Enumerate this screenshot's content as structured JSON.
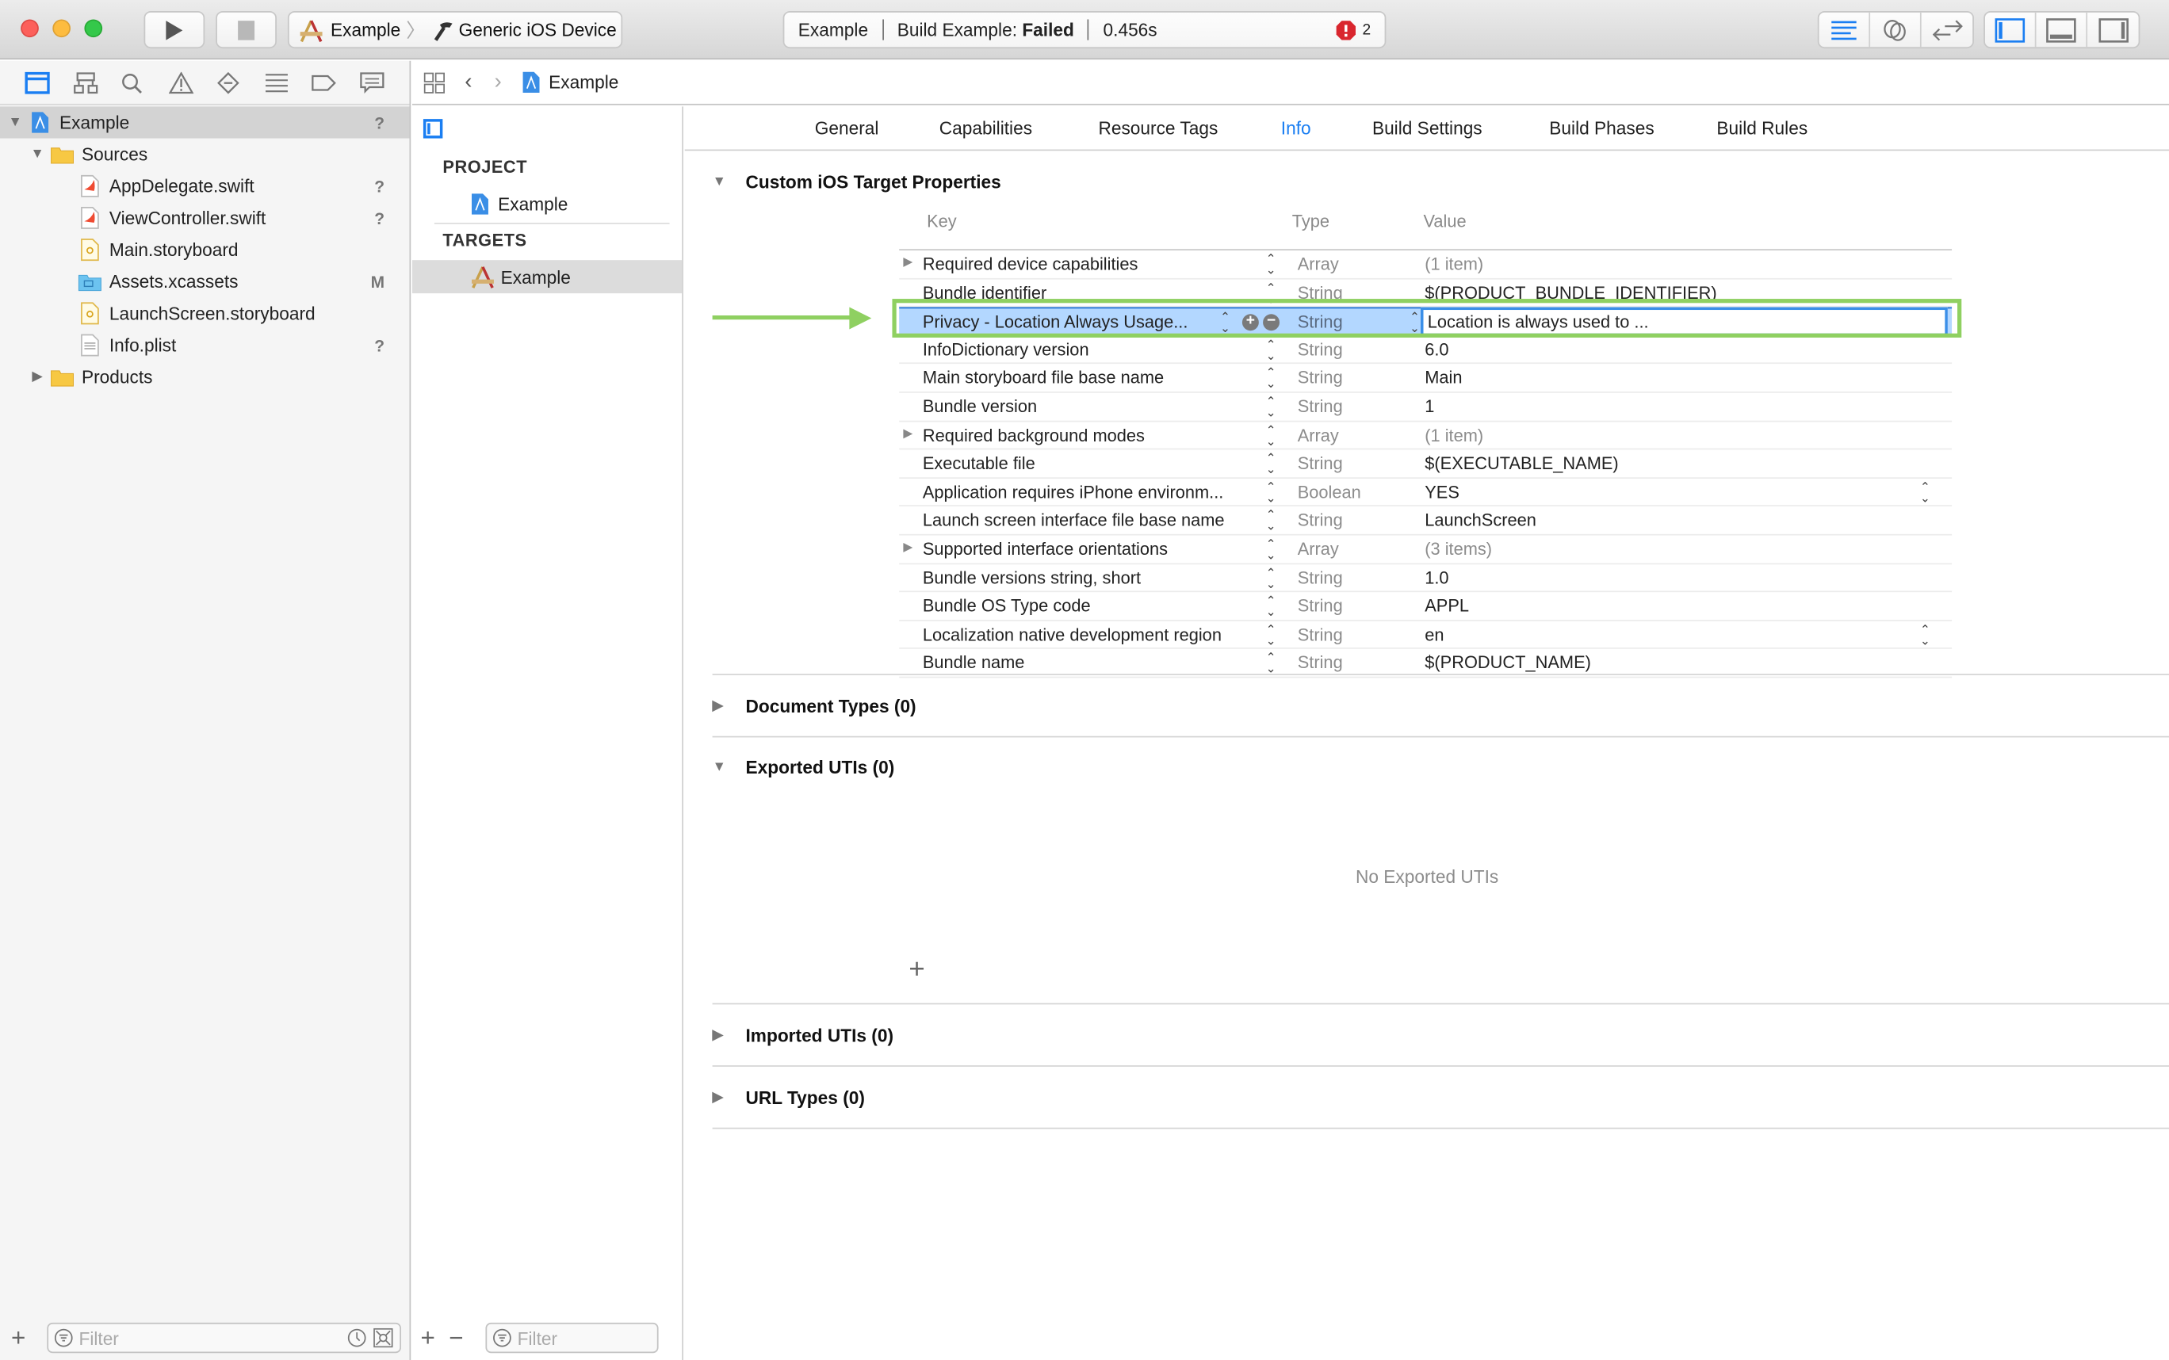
{
  "window": {
    "scheme": {
      "project": "Example",
      "device": "Generic iOS Device"
    },
    "activity": {
      "project": "Example",
      "status_prefix": "Build Example: ",
      "status": "Failed",
      "duration": "0.456s",
      "error_count": "2"
    },
    "colors": {
      "accent": "#1a7ef2",
      "error": "#d9262e",
      "highlight": "#8fd061",
      "selection": "#b3d7ff"
    }
  },
  "navigator": {
    "tabs": [
      "project-navigator-icon",
      "symbol-navigator-icon",
      "find-navigator-icon",
      "issue-navigator-icon",
      "test-navigator-icon",
      "debug-navigator-icon",
      "breakpoint-navigator-icon",
      "report-navigator-icon"
    ],
    "tree": [
      {
        "label": "Example",
        "level": 0,
        "icon": "xcodeproj-icon",
        "disclosure": "open",
        "badge": "?",
        "selected": true
      },
      {
        "label": "Sources",
        "level": 1,
        "icon": "folder-icon",
        "disclosure": "open",
        "badge": ""
      },
      {
        "label": "AppDelegate.swift",
        "level": 2,
        "icon": "swift-file-icon",
        "badge": "?"
      },
      {
        "label": "ViewController.swift",
        "level": 2,
        "icon": "swift-file-icon",
        "badge": "?"
      },
      {
        "label": "Main.storyboard",
        "level": 2,
        "icon": "storyboard-file-icon",
        "badge": ""
      },
      {
        "label": "Assets.xcassets",
        "level": 2,
        "icon": "asset-catalog-icon",
        "badge": "M"
      },
      {
        "label": "LaunchScreen.storyboard",
        "level": 2,
        "icon": "storyboard-file-icon",
        "badge": ""
      },
      {
        "label": "Info.plist",
        "level": 2,
        "icon": "plist-file-icon",
        "badge": "?"
      },
      {
        "label": "Products",
        "level": 1,
        "icon": "folder-icon",
        "disclosure": "closed",
        "badge": ""
      }
    ],
    "filter_placeholder": "Filter"
  },
  "jumpbar": {
    "file": "Example"
  },
  "targets_panel": {
    "project_header": "PROJECT",
    "project_item": "Example",
    "targets_header": "TARGETS",
    "target_item": "Example",
    "filter_placeholder": "Filter"
  },
  "editor_tabs": [
    {
      "label": "General",
      "active": false
    },
    {
      "label": "Capabilities",
      "active": false
    },
    {
      "label": "Resource Tags",
      "active": false
    },
    {
      "label": "Info",
      "active": true
    },
    {
      "label": "Build Settings",
      "active": false
    },
    {
      "label": "Build Phases",
      "active": false
    },
    {
      "label": "Build Rules",
      "active": false
    }
  ],
  "info": {
    "custom_properties_title": "Custom iOS Target Properties",
    "columns": {
      "key": "Key",
      "type": "Type",
      "value": "Value"
    },
    "rows": [
      {
        "key": "Required device capabilities",
        "type": "Array",
        "value": "(1 item)",
        "expandable": true,
        "dim_value": true
      },
      {
        "key": "Bundle identifier",
        "type": "String",
        "value": "$(PRODUCT_BUNDLE_IDENTIFIER)"
      },
      {
        "key": "Privacy - Location Always Usage...",
        "type": "String",
        "value": "Location is always used to ...",
        "selected": true,
        "editing": true
      },
      {
        "key": "InfoDictionary version",
        "type": "String",
        "value": "6.0"
      },
      {
        "key": "Main storyboard file base name",
        "type": "String",
        "value": "Main"
      },
      {
        "key": "Bundle version",
        "type": "String",
        "value": "1"
      },
      {
        "key": "Required background modes",
        "type": "Array",
        "value": "(1 item)",
        "expandable": true,
        "dim_value": true
      },
      {
        "key": "Executable file",
        "type": "String",
        "value": "$(EXECUTABLE_NAME)"
      },
      {
        "key": "Application requires iPhone environm...",
        "type": "Boolean",
        "value": "YES",
        "value_popup": true
      },
      {
        "key": "Launch screen interface file base name",
        "type": "String",
        "value": "LaunchScreen"
      },
      {
        "key": "Supported interface orientations",
        "type": "Array",
        "value": "(3 items)",
        "expandable": true,
        "dim_value": true
      },
      {
        "key": "Bundle versions string, short",
        "type": "String",
        "value": "1.0"
      },
      {
        "key": "Bundle OS Type code",
        "type": "String",
        "value": "APPL"
      },
      {
        "key": "Localization native development region",
        "type": "String",
        "value": "en",
        "value_popup": true
      },
      {
        "key": "Bundle name",
        "type": "String",
        "value": "$(PRODUCT_NAME)"
      }
    ],
    "sections": {
      "document_types": "Document Types (0)",
      "exported_utis": "Exported UTIs (0)",
      "exported_empty": "No Exported UTIs",
      "imported_utis": "Imported UTIs (0)",
      "url_types": "URL Types (0)"
    }
  }
}
